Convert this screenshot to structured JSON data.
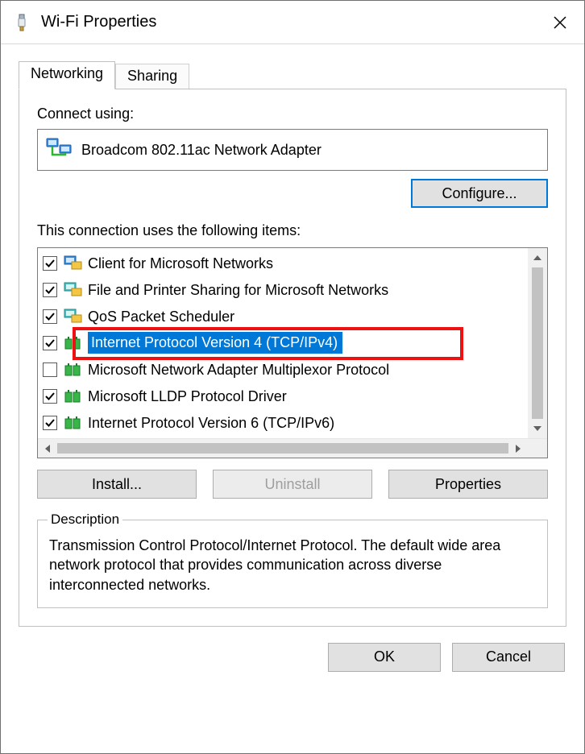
{
  "window": {
    "title": "Wi-Fi Properties"
  },
  "tabs": [
    {
      "label": "Networking",
      "active": true
    },
    {
      "label": "Sharing",
      "active": false
    }
  ],
  "connect_label": "Connect using:",
  "adapter_name": "Broadcom 802.11ac Network Adapter",
  "configure_btn": "Configure...",
  "items_label": "This connection uses the following items:",
  "items": [
    {
      "checked": true,
      "icon": "proto-blue",
      "label": "Client for Microsoft Networks"
    },
    {
      "checked": true,
      "icon": "proto-teal",
      "label": "File and Printer Sharing for Microsoft Networks"
    },
    {
      "checked": true,
      "icon": "proto-teal",
      "label": "QoS Packet Scheduler"
    },
    {
      "checked": true,
      "icon": "proto-green",
      "label": "Internet Protocol Version 4 (TCP/IPv4)",
      "selected": true
    },
    {
      "checked": false,
      "icon": "proto-green",
      "label": "Microsoft Network Adapter Multiplexor Protocol"
    },
    {
      "checked": true,
      "icon": "proto-green",
      "label": "Microsoft LLDP Protocol Driver"
    },
    {
      "checked": true,
      "icon": "proto-green",
      "label": "Internet Protocol Version 6 (TCP/IPv6)"
    }
  ],
  "install_btn": "Install...",
  "uninstall_btn": "Uninstall",
  "properties_btn": "Properties",
  "description": {
    "legend": "Description",
    "text": "Transmission Control Protocol/Internet Protocol. The default wide area network protocol that provides communication across diverse interconnected networks."
  },
  "ok_btn": "OK",
  "cancel_btn": "Cancel"
}
